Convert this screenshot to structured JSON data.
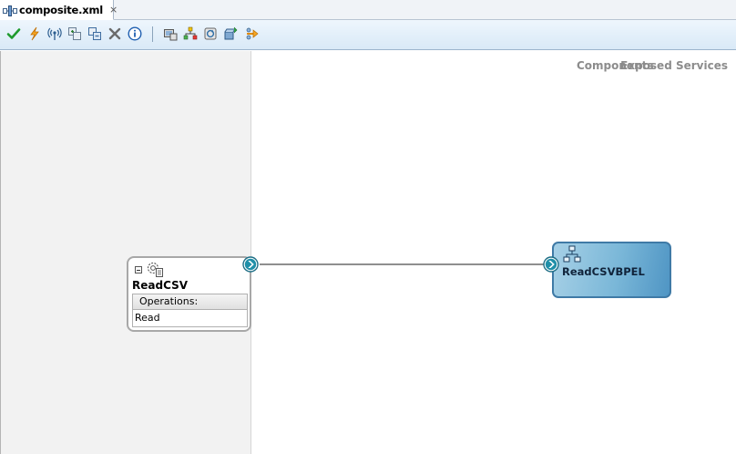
{
  "editor": {
    "tab": {
      "icon": "composite-icon",
      "label": "composite.xml",
      "close_label": "×"
    }
  },
  "toolbar": {
    "buttons": [
      {
        "name": "validate-button",
        "icon": "checkmark-icon"
      },
      {
        "name": "test-button",
        "icon": "lightning-icon"
      },
      {
        "name": "signal-button",
        "icon": "broadcast-icon"
      },
      {
        "name": "add-component-button",
        "icon": "add-component-icon"
      },
      {
        "name": "remove-component-button",
        "icon": "remove-component-icon"
      },
      {
        "name": "delete-button",
        "icon": "x-icon"
      },
      {
        "name": "info-button",
        "icon": "info-icon"
      },
      {
        "name": "deploy-button",
        "icon": "deploy-icon"
      },
      {
        "name": "layout-button",
        "icon": "layout-icon"
      },
      {
        "name": "refresh-button",
        "icon": "refresh-icon"
      },
      {
        "name": "export-button",
        "icon": "export-icon"
      },
      {
        "name": "wire-button",
        "icon": "wire-icon"
      }
    ]
  },
  "canvas": {
    "lanes": {
      "exposed_services_title": "Exposed Services",
      "components_title": "Components"
    },
    "service": {
      "name": "ReadCSV",
      "icon": "adapter-gear-icon",
      "operations_header": "Operations:",
      "operations": [
        "Read"
      ]
    },
    "component": {
      "name": "ReadCSVBPEL",
      "icon": "bpel-process-icon"
    },
    "colors": {
      "component_fill": "#7ab7d8",
      "component_border": "#3f7aa6",
      "port_fill": "#1f8fa8",
      "wire": "#8f8f8f"
    }
  }
}
